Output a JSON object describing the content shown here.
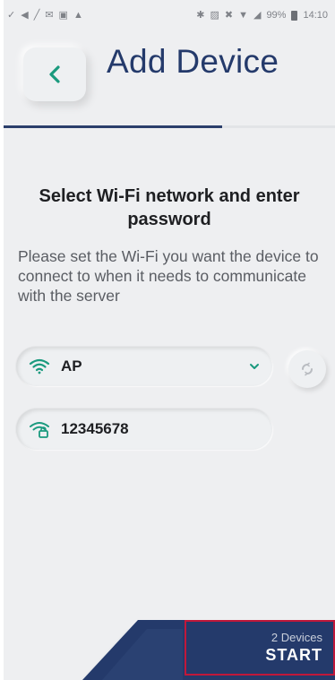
{
  "status_bar": {
    "battery": "99%",
    "time": "14:10"
  },
  "header": {
    "title": "Add Device",
    "back_icon": "chevron-left-icon"
  },
  "progress": {
    "fraction": 0.66
  },
  "content": {
    "title": "Select Wi-Fi network and enter password",
    "description": "Please set the Wi-Fi you want the device to connect to when it needs to communicate with the server"
  },
  "wifi": {
    "selected_network": "AP",
    "icon": "wifi-icon"
  },
  "password": {
    "value": "12345678",
    "icon": "wifi-lock-icon"
  },
  "footer": {
    "device_count": "2 Devices",
    "start_label": "START"
  },
  "colors": {
    "accent_green": "#1a9a7e",
    "navy": "#243a6b",
    "highlight_red": "#c0183a"
  }
}
